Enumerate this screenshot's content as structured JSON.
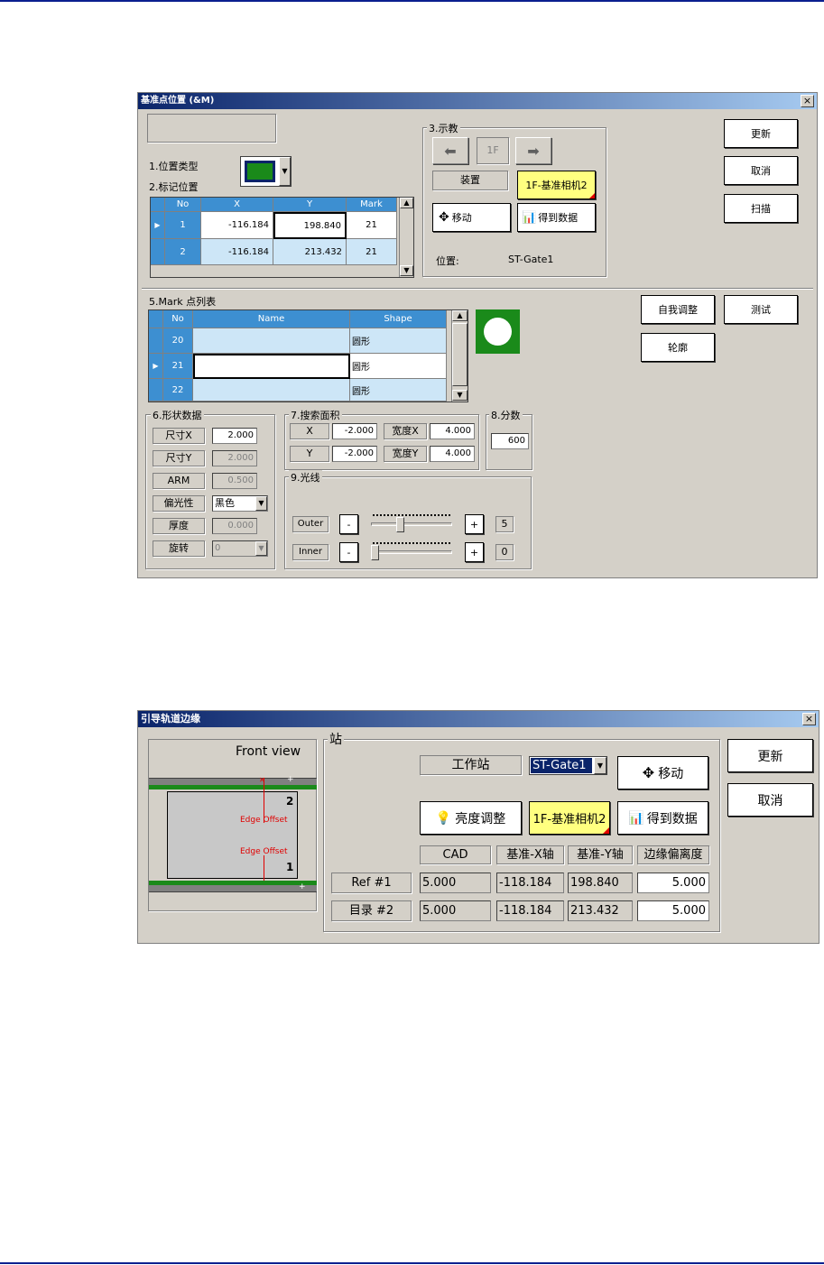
{
  "dialog1": {
    "title": "基准点位置 (&M)",
    "close": "×",
    "position_type_label": "1.位置类型",
    "mark_position_label": "2.标记位置",
    "mark_table": {
      "headers": [
        "No",
        "X",
        "Y",
        "Mark"
      ],
      "rows": [
        {
          "no": "1",
          "x": "-116.184",
          "y": "198.840",
          "mark": "21"
        },
        {
          "no": "2",
          "x": "-116.184",
          "y": "213.432",
          "mark": "21"
        }
      ]
    },
    "teach": {
      "label": "3.示教",
      "layer": "1F",
      "device_label": "装置",
      "camera_button": "1F-基准相机2",
      "move_button": "移动",
      "getdata_button": "得到数据",
      "position_label": "位置:",
      "position_value": "ST-Gate1"
    },
    "update_button": "更新",
    "cancel_button": "取消",
    "scan_button": "扫描",
    "mark_list_label": "5.Mark 点列表",
    "mark_list": {
      "headers": [
        "No",
        "Name",
        "Shape"
      ],
      "rows": [
        {
          "no": "20",
          "name": "",
          "shape": "圆形"
        },
        {
          "no": "21",
          "name": "",
          "shape": "圆形"
        },
        {
          "no": "22",
          "name": "",
          "shape": "圆形"
        }
      ]
    },
    "self_adjust_button": "自我调整",
    "test_button": "测试",
    "contour_button": "轮廓",
    "shape": {
      "label": "6.形状数据",
      "size_x_label": "尺寸X",
      "size_x": "2.000",
      "size_y_label": "尺寸Y",
      "size_y": "2.000",
      "arm_label": "ARM",
      "arm": "0.500",
      "polarity_label": "偏光性",
      "polarity": "黑色",
      "thickness_label": "厚度",
      "thickness": "0.000",
      "rotation_label": "旋转",
      "rotation": "0"
    },
    "search": {
      "label": "7.搜索面积",
      "x_label": "X",
      "x": "-2.000",
      "y_label": "Y",
      "y": "-2.000",
      "wx_label": "宽度X",
      "wx": "4.000",
      "wy_label": "宽度Y",
      "wy": "4.000"
    },
    "score": {
      "label": "8.分数",
      "value": "600"
    },
    "light": {
      "label": "9.光线",
      "outer_label": "Outer",
      "outer_value": "5",
      "outer_level": 0.34,
      "inner_label": "Inner",
      "inner_value": "0",
      "inner_level": 0.0,
      "minus": "-",
      "plus": "+"
    }
  },
  "dialog2": {
    "title": "引导轨道边缘",
    "close": "×",
    "front_view": "Front view",
    "num2": "2",
    "num1": "1",
    "plus": "+",
    "edge_offset_top": "Edge Offset",
    "edge_offset_bottom": "Edge Offset",
    "station_group": "站",
    "workstation_label": "工作站",
    "workstation_value": "ST-Gate1",
    "move_button": "移动",
    "brightness_button": "亮度调整",
    "camera_button": "1F-基准相机2",
    "getdata_button": "得到数据",
    "update_button": "更新",
    "cancel_button": "取消",
    "table": {
      "headers": [
        "CAD",
        "基准-X轴",
        "基准-Y轴",
        "边缘偏离度"
      ],
      "rows": [
        {
          "label": "Ref #1",
          "cad": "5.000",
          "x": "-118.184",
          "y": "198.840",
          "edge": "5.000"
        },
        {
          "label": "目录 #2",
          "cad": "5.000",
          "x": "-118.184",
          "y": "213.432",
          "edge": "5.000"
        }
      ]
    }
  }
}
